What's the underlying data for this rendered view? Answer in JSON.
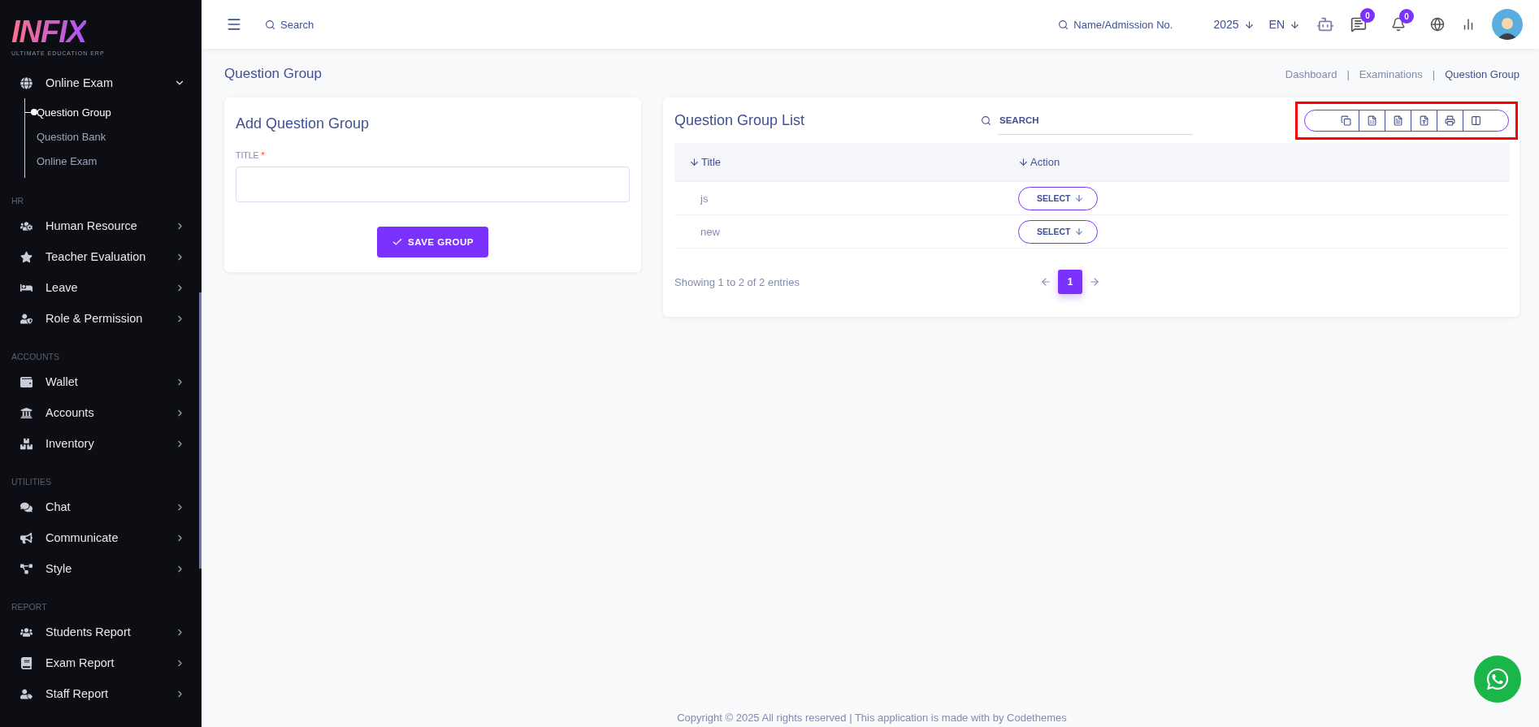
{
  "sidebar": {
    "logo": {
      "wordmark": "INFIX",
      "tagline": "ULTIMATE EDUCATION ERP"
    },
    "open_menu": {
      "label": "Online Exam",
      "expanded": true,
      "children": [
        {
          "label": "Question Group",
          "selected": true
        },
        {
          "label": "Question Bank",
          "selected": false
        },
        {
          "label": "Online Exam",
          "selected": false
        }
      ]
    },
    "sections": [
      {
        "heading": "HR",
        "items": [
          {
            "label": "Human Resource"
          },
          {
            "label": "Teacher Evaluation"
          },
          {
            "label": "Leave"
          },
          {
            "label": "Role & Permission"
          }
        ]
      },
      {
        "heading": "ACCOUNTS",
        "items": [
          {
            "label": "Wallet"
          },
          {
            "label": "Accounts"
          },
          {
            "label": "Inventory"
          }
        ]
      },
      {
        "heading": "UTILITIES",
        "items": [
          {
            "label": "Chat"
          },
          {
            "label": "Communicate"
          },
          {
            "label": "Style"
          }
        ]
      },
      {
        "heading": "REPORT",
        "items": [
          {
            "label": "Students Report"
          },
          {
            "label": "Exam Report"
          },
          {
            "label": "Staff Report"
          }
        ]
      }
    ]
  },
  "header": {
    "search": {
      "placeholder": "Search"
    },
    "student_search": {
      "placeholder": "Name/Admission No."
    },
    "year": "2025",
    "language": "EN",
    "chat_badge": "0",
    "bell_badge": "0"
  },
  "page": {
    "title": "Question Group",
    "breadcrumb": [
      "Dashboard",
      "Examinations",
      "Question Group"
    ],
    "breadcrumb_separators": [
      "|",
      "|"
    ]
  },
  "add_form": {
    "title": "Add Question Group",
    "field": {
      "label": "TITLE",
      "required_mark": "*"
    },
    "button": "SAVE GROUP"
  },
  "list": {
    "title": "Question Group List",
    "search": {
      "placeholder": "SEARCH"
    },
    "export_highlighted": true,
    "export_buttons": [
      {
        "kind": "copy"
      },
      {
        "kind": "excel"
      },
      {
        "kind": "csv"
      },
      {
        "kind": "pdf"
      },
      {
        "kind": "print"
      },
      {
        "kind": "columns"
      }
    ],
    "columns": [
      "Title",
      "Action"
    ],
    "rows": [
      {
        "title": "js",
        "action": "SELECT"
      },
      {
        "title": "new",
        "action": "SELECT"
      }
    ],
    "info": "Showing 1 to 2 of 2 entries",
    "pages": [
      {
        "label": "1",
        "selected": true
      }
    ]
  },
  "footer": "Copyright © 2025 All rights reserved | This application is made with by Codethemes"
}
